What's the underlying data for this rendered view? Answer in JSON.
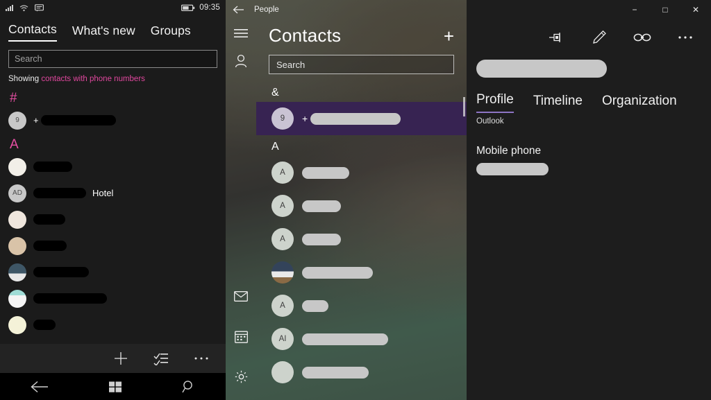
{
  "phone": {
    "status_bar": {
      "signal_icon": "signal-bars-icon",
      "wifi_icon": "wifi-icon",
      "message_icon": "messaging-icon",
      "battery_icon": "battery-icon",
      "time": "09:35"
    },
    "tabs": [
      {
        "label": "Contacts",
        "active": true
      },
      {
        "label": "What's new",
        "active": false
      },
      {
        "label": "Groups",
        "active": false
      }
    ],
    "search": {
      "placeholder": "Search",
      "value": ""
    },
    "showing": {
      "prefix": "Showing",
      "filter_link": "contacts with phone numbers"
    },
    "groups": [
      {
        "letter": "#",
        "rows": [
          {
            "avatar_type": "initials",
            "initials": "9",
            "prefix": "+",
            "name_redacted": true,
            "redact_width": 108,
            "suffix": ""
          }
        ]
      },
      {
        "letter": "A",
        "rows": [
          {
            "avatar_type": "photo",
            "avatar_color": "#f2efe8",
            "initials": "",
            "prefix": "",
            "name_redacted": true,
            "redact_width": 56,
            "suffix": ""
          },
          {
            "avatar_type": "initials",
            "initials": "AD",
            "prefix": "",
            "name_redacted": true,
            "redact_width": 76,
            "suffix": "Hotel"
          },
          {
            "avatar_type": "photo",
            "avatar_color": "#efe6dd",
            "initials": "",
            "prefix": "",
            "name_redacted": true,
            "redact_width": 46,
            "suffix": ""
          },
          {
            "avatar_type": "photo",
            "avatar_color": "#d9c3a8",
            "initials": "",
            "prefix": "",
            "name_redacted": true,
            "redact_width": 48,
            "suffix": ""
          },
          {
            "avatar_type": "photo",
            "avatar_color": "#3e5666",
            "initials": "",
            "prefix": "",
            "name_redacted": true,
            "redact_width": 80,
            "suffix": ""
          },
          {
            "avatar_type": "photo",
            "avatar_color": "#dff1ee",
            "initials": "",
            "prefix": "",
            "name_redacted": true,
            "redact_width": 106,
            "suffix": ""
          },
          {
            "avatar_type": "photo",
            "avatar_color": "#f4f2d8",
            "initials": "",
            "prefix": "",
            "name_redacted": true,
            "redact_width": 32,
            "suffix": ""
          }
        ]
      }
    ],
    "app_bar": {
      "add_icon": "plus-icon",
      "select_icon": "select-list-icon",
      "more_icon": "ellipsis-icon"
    },
    "nav_bar": {
      "back_icon": "back-arrow-icon",
      "start_icon": "windows-start-icon",
      "search_icon": "search-icon"
    }
  },
  "people": {
    "app_title": "People",
    "back_icon": "back-arrow-icon",
    "title": "Contacts",
    "add_icon": "plus-icon",
    "menu_icon": "hamburger-menu-icon",
    "rail": [
      {
        "icon": "person-icon",
        "name": "people-rail-icon"
      },
      {
        "icon": "mail-icon",
        "name": "mail-rail-icon"
      },
      {
        "icon": "calendar-icon",
        "name": "calendar-rail-icon"
      },
      {
        "icon": "gear-icon",
        "name": "settings-rail-icon"
      }
    ],
    "search": {
      "placeholder": "Search",
      "value": ""
    },
    "selection_color": "#372352",
    "groups": [
      {
        "letter": "&",
        "rows": [
          {
            "avatar_type": "initials",
            "initials": "9",
            "prefix": "+",
            "redact_width": 130,
            "selected": true
          }
        ]
      },
      {
        "letter": "A",
        "rows": [
          {
            "avatar_type": "initials",
            "initials": "A",
            "prefix": "",
            "redact_width": 68,
            "selected": false
          },
          {
            "avatar_type": "initials",
            "initials": "A",
            "prefix": "",
            "redact_width": 56,
            "selected": false
          },
          {
            "avatar_type": "initials",
            "initials": "A",
            "prefix": "",
            "redact_width": 56,
            "selected": false
          },
          {
            "avatar_type": "photo",
            "avatar_color": "#33435a",
            "initials": "",
            "prefix": "",
            "redact_width": 102,
            "selected": false
          },
          {
            "avatar_type": "initials",
            "initials": "A",
            "prefix": "",
            "redact_width": 38,
            "selected": false
          },
          {
            "avatar_type": "initials",
            "initials": "AI",
            "prefix": "",
            "redact_width": 124,
            "selected": false
          },
          {
            "avatar_type": "initials",
            "initials": "",
            "prefix": "",
            "redact_width": 96,
            "selected": false
          }
        ]
      }
    ]
  },
  "detail": {
    "window_controls": {
      "minimize": "−",
      "maximize": "□",
      "close": "✕"
    },
    "toolbar": [
      {
        "icon": "pin-icon",
        "name": "pin-button"
      },
      {
        "icon": "pencil-icon",
        "name": "edit-button"
      },
      {
        "icon": "link-icon",
        "name": "link-contacts-button"
      },
      {
        "icon": "ellipsis-icon",
        "name": "more-options-button"
      }
    ],
    "contact_name_redacted": true,
    "contact_name_width": 188,
    "tabs": [
      {
        "label": "Profile",
        "active": true
      },
      {
        "label": "Timeline",
        "active": false
      },
      {
        "label": "Organization",
        "active": false
      }
    ],
    "accent_color": "#8d74c4",
    "source": "Outlook",
    "fields": [
      {
        "label": "Mobile phone",
        "value_redacted": true,
        "value_width": 104
      }
    ]
  }
}
